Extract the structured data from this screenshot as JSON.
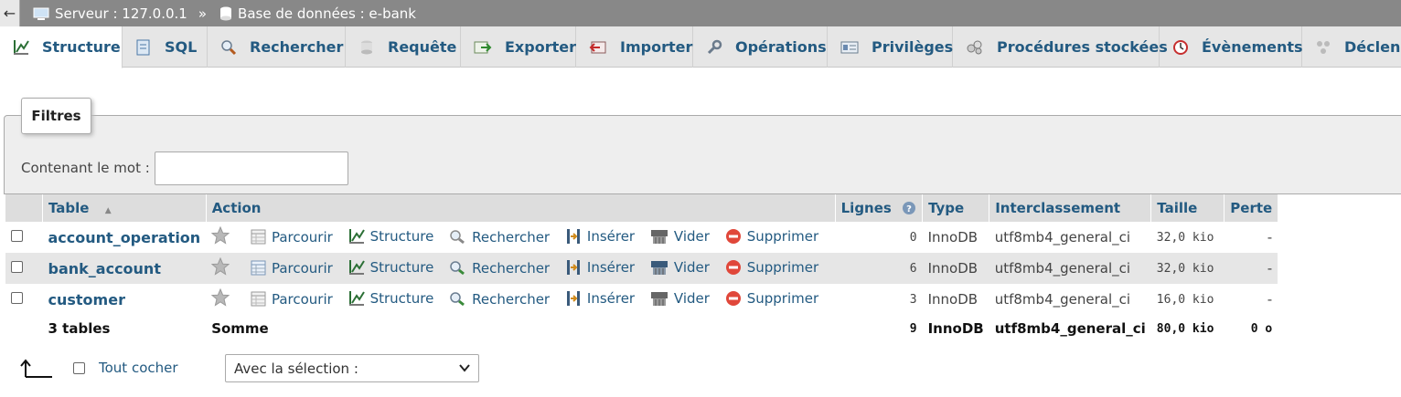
{
  "topbar": {
    "back_glyph": "←",
    "server_label": "Serveur : 127.0.0.1",
    "separator": "»",
    "database_label": "Base de données : e-bank"
  },
  "tabs": [
    {
      "label": "Structure",
      "icon": "structure-icon",
      "active": true
    },
    {
      "label": "SQL",
      "icon": "sql-icon"
    },
    {
      "label": "Rechercher",
      "icon": "search-icon"
    },
    {
      "label": "Requête",
      "icon": "query-icon"
    },
    {
      "label": "Exporter",
      "icon": "export-icon"
    },
    {
      "label": "Importer",
      "icon": "import-icon"
    },
    {
      "label": "Opérations",
      "icon": "wrench-icon"
    },
    {
      "label": "Privilèges",
      "icon": "privileges-icon"
    },
    {
      "label": "Procédures stockées",
      "icon": "routines-icon"
    },
    {
      "label": "Évènements",
      "icon": "clock-icon"
    },
    {
      "label": "Déclenc",
      "icon": "triggers-icon"
    }
  ],
  "filters": {
    "legend": "Filtres",
    "label": "Contenant le mot :",
    "value": ""
  },
  "table": {
    "headers": {
      "table": "Table",
      "sort_glyph": "▲",
      "action": "Action",
      "lignes": "Lignes",
      "type": "Type",
      "interclassement": "Interclassement",
      "taille": "Taille",
      "perte": "Perte"
    },
    "actions": {
      "parcourir": "Parcourir",
      "structure": "Structure",
      "rechercher": "Rechercher",
      "inserer": "Insérer",
      "vider": "Vider",
      "supprimer": "Supprimer"
    },
    "rows": [
      {
        "name": "account_operation",
        "lignes": "0",
        "type": "InnoDB",
        "collation": "utf8mb4_general_ci",
        "taille": "32,0 kio",
        "perte": "-"
      },
      {
        "name": "bank_account",
        "lignes": "6",
        "type": "InnoDB",
        "collation": "utf8mb4_general_ci",
        "taille": "32,0 kio",
        "perte": "-"
      },
      {
        "name": "customer",
        "lignes": "3",
        "type": "InnoDB",
        "collation": "utf8mb4_general_ci",
        "taille": "16,0 kio",
        "perte": "-"
      }
    ],
    "footer": {
      "count": "3 tables",
      "label": "Somme",
      "lignes": "9",
      "type": "InnoDB",
      "collation": "utf8mb4_general_ci",
      "taille": "80,0 kio",
      "perte": "0 o"
    }
  },
  "bottom": {
    "check_all_label": "Tout cocher",
    "selection_placeholder": "Avec la sélection :"
  }
}
